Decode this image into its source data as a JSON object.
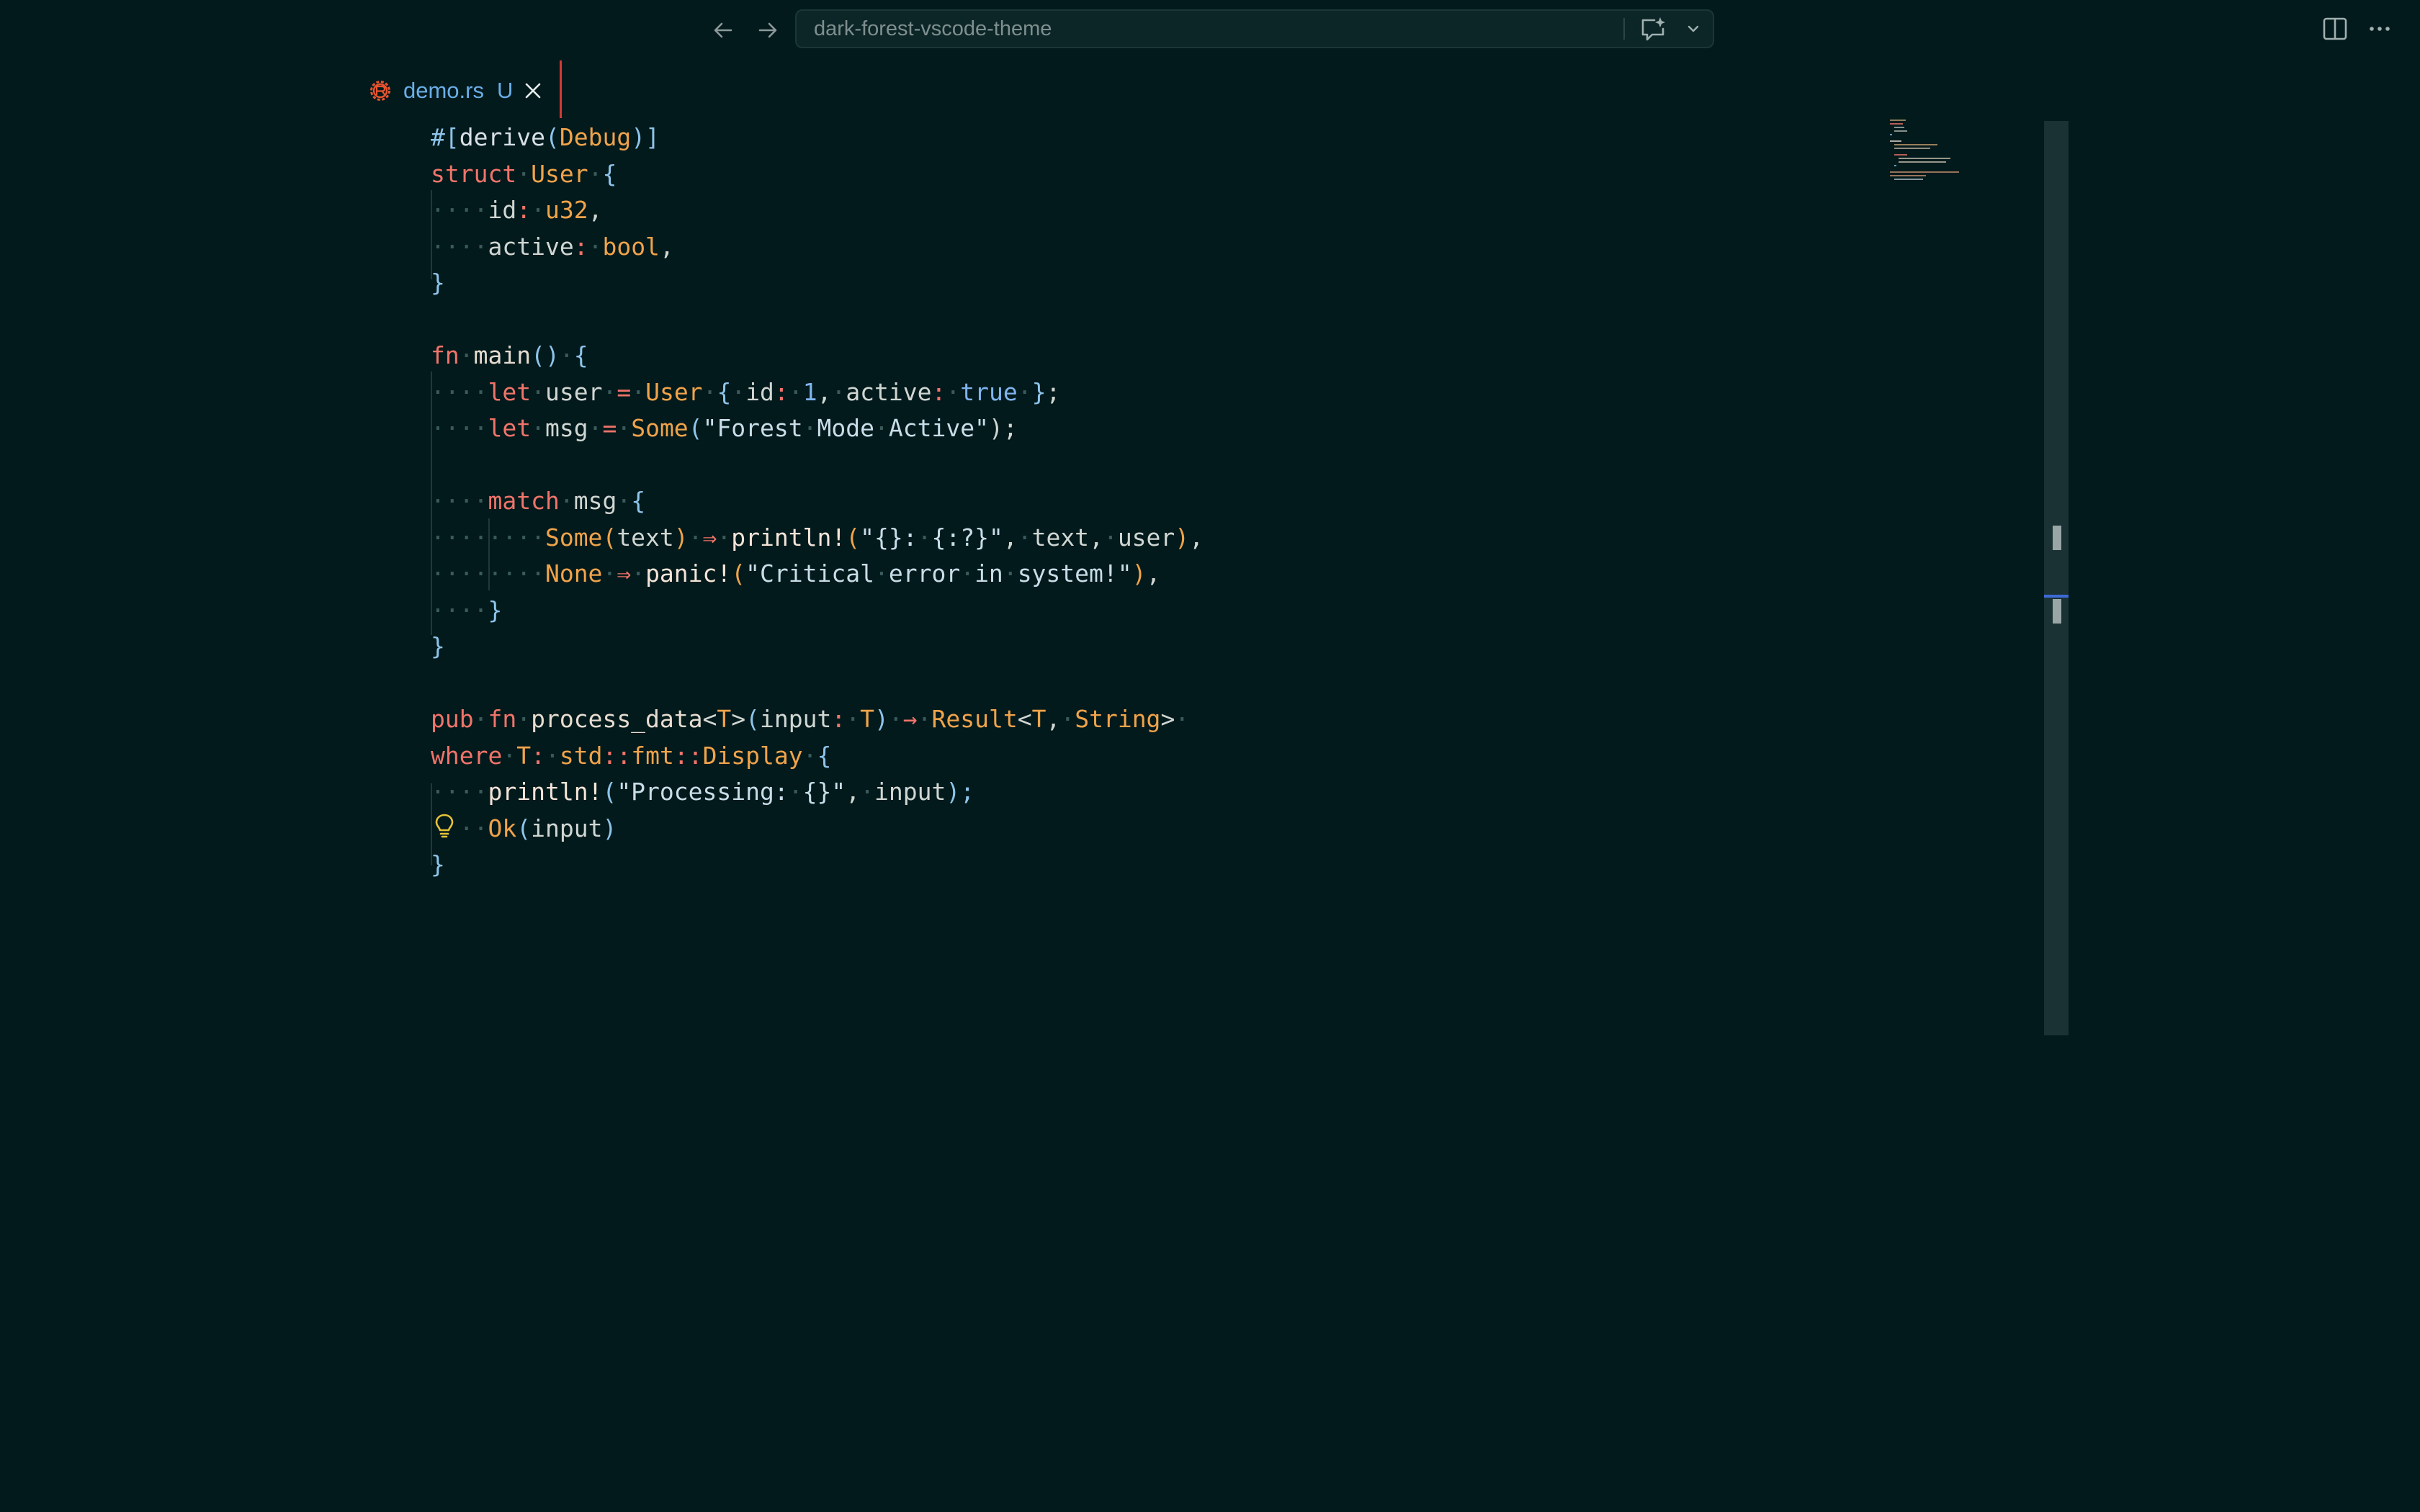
{
  "titlebar": {
    "search_text": "dark-forest-vscode-theme",
    "icons": [
      "arrow-left-icon",
      "arrow-right-icon",
      "chat-sparkle-icon",
      "chevron-down-icon",
      "split-editor-icon",
      "more-icon"
    ]
  },
  "tab": {
    "name": "demo.rs",
    "status": "U",
    "icon": "rust-gear-icon",
    "close_icon": "close-icon"
  },
  "colors": {
    "background": "#031a1c",
    "keyword": "#f0746a",
    "type": "#f0a34a",
    "punctuation": "#8ec4ea",
    "tab_accent": "#d23b32",
    "tab_label": "#6aaee8",
    "cursor_marker": "#3d6ad6"
  },
  "editor": {
    "language": "rust",
    "lines": [
      [
        {
          "t": "#[",
          "c": "pn"
        },
        {
          "t": "derive",
          "c": "attr"
        },
        {
          "t": "(",
          "c": "pn"
        },
        {
          "t": "Debug",
          "c": "ty"
        },
        {
          "t": ")]",
          "c": "pn"
        }
      ],
      [
        {
          "t": "struct",
          "c": "kw"
        },
        {
          "t": "·",
          "c": "ws"
        },
        {
          "t": "User",
          "c": "ty"
        },
        {
          "t": "·",
          "c": "ws"
        },
        {
          "t": "{",
          "c": "pn"
        }
      ],
      [
        {
          "t": "····",
          "c": "ws"
        },
        {
          "t": "id",
          "c": "id"
        },
        {
          "t": ":",
          "c": "kw"
        },
        {
          "t": "·",
          "c": "ws"
        },
        {
          "t": "u32",
          "c": "ty"
        },
        {
          "t": ",",
          "c": "id"
        }
      ],
      [
        {
          "t": "····",
          "c": "ws"
        },
        {
          "t": "active",
          "c": "id"
        },
        {
          "t": ":",
          "c": "kw"
        },
        {
          "t": "·",
          "c": "ws"
        },
        {
          "t": "bool",
          "c": "ty"
        },
        {
          "t": ",",
          "c": "id"
        }
      ],
      [
        {
          "t": "}",
          "c": "pn"
        }
      ],
      [],
      [
        {
          "t": "fn",
          "c": "kw"
        },
        {
          "t": "·",
          "c": "ws"
        },
        {
          "t": "main",
          "c": "fnn"
        },
        {
          "t": "()",
          "c": "pn"
        },
        {
          "t": "·",
          "c": "ws"
        },
        {
          "t": "{",
          "c": "pn"
        }
      ],
      [
        {
          "t": "····",
          "c": "ws"
        },
        {
          "t": "let",
          "c": "kw"
        },
        {
          "t": "·",
          "c": "ws"
        },
        {
          "t": "user",
          "c": "id"
        },
        {
          "t": "·",
          "c": "ws"
        },
        {
          "t": "=",
          "c": "kw"
        },
        {
          "t": "·",
          "c": "ws"
        },
        {
          "t": "User",
          "c": "ty"
        },
        {
          "t": "·",
          "c": "ws"
        },
        {
          "t": "{",
          "c": "pn"
        },
        {
          "t": "·",
          "c": "ws"
        },
        {
          "t": "id",
          "c": "id"
        },
        {
          "t": ":",
          "c": "kw"
        },
        {
          "t": "·",
          "c": "ws"
        },
        {
          "t": "1",
          "c": "nm"
        },
        {
          "t": ",",
          "c": "id"
        },
        {
          "t": "·",
          "c": "ws"
        },
        {
          "t": "active",
          "c": "id"
        },
        {
          "t": ":",
          "c": "kw"
        },
        {
          "t": "·",
          "c": "ws"
        },
        {
          "t": "true",
          "c": "nm"
        },
        {
          "t": "·",
          "c": "ws"
        },
        {
          "t": "}",
          "c": "pn"
        },
        {
          "t": ";",
          "c": "id"
        }
      ],
      [
        {
          "t": "····",
          "c": "ws"
        },
        {
          "t": "let",
          "c": "kw"
        },
        {
          "t": "·",
          "c": "ws"
        },
        {
          "t": "msg",
          "c": "id"
        },
        {
          "t": "·",
          "c": "ws"
        },
        {
          "t": "=",
          "c": "kw"
        },
        {
          "t": "·",
          "c": "ws"
        },
        {
          "t": "Some",
          "c": "ty"
        },
        {
          "t": "(",
          "c": "pn"
        },
        {
          "t": "\"Forest",
          "c": "st"
        },
        {
          "t": "·",
          "c": "ws"
        },
        {
          "t": "Mode",
          "c": "st"
        },
        {
          "t": "·",
          "c": "ws"
        },
        {
          "t": "Active\"",
          "c": "st"
        },
        {
          "t": ");",
          "c": "id"
        }
      ],
      [],
      [
        {
          "t": "····",
          "c": "ws"
        },
        {
          "t": "match",
          "c": "kw"
        },
        {
          "t": "·",
          "c": "ws"
        },
        {
          "t": "msg",
          "c": "id"
        },
        {
          "t": "·",
          "c": "ws"
        },
        {
          "t": "{",
          "c": "pn"
        }
      ],
      [
        {
          "t": "········",
          "c": "ws"
        },
        {
          "t": "Some",
          "c": "ty"
        },
        {
          "t": "(",
          "c": "ty"
        },
        {
          "t": "text",
          "c": "id"
        },
        {
          "t": ")",
          "c": "ty"
        },
        {
          "t": "·",
          "c": "ws"
        },
        {
          "t": "⇒",
          "c": "ar"
        },
        {
          "t": "·",
          "c": "ws"
        },
        {
          "t": "println!",
          "c": "mac"
        },
        {
          "t": "(",
          "c": "ty"
        },
        {
          "t": "\"{}:",
          "c": "st"
        },
        {
          "t": "·",
          "c": "ws"
        },
        {
          "t": "{:?}\"",
          "c": "st"
        },
        {
          "t": ",",
          "c": "id"
        },
        {
          "t": "·",
          "c": "ws"
        },
        {
          "t": "text",
          "c": "id"
        },
        {
          "t": ",",
          "c": "id"
        },
        {
          "t": "·",
          "c": "ws"
        },
        {
          "t": "user",
          "c": "id"
        },
        {
          "t": ")",
          "c": "ty"
        },
        {
          "t": ",",
          "c": "id"
        }
      ],
      [
        {
          "t": "········",
          "c": "ws"
        },
        {
          "t": "None",
          "c": "ty"
        },
        {
          "t": "·",
          "c": "ws"
        },
        {
          "t": "⇒",
          "c": "ar"
        },
        {
          "t": "·",
          "c": "ws"
        },
        {
          "t": "panic!",
          "c": "mac"
        },
        {
          "t": "(",
          "c": "ty"
        },
        {
          "t": "\"Critical",
          "c": "st"
        },
        {
          "t": "·",
          "c": "ws"
        },
        {
          "t": "error",
          "c": "st"
        },
        {
          "t": "·",
          "c": "ws"
        },
        {
          "t": "in",
          "c": "st"
        },
        {
          "t": "·",
          "c": "ws"
        },
        {
          "t": "system!\"",
          "c": "st"
        },
        {
          "t": ")",
          "c": "ty"
        },
        {
          "t": ",",
          "c": "id"
        }
      ],
      [
        {
          "t": "····",
          "c": "ws"
        },
        {
          "t": "}",
          "c": "pn"
        }
      ],
      [
        {
          "t": "}",
          "c": "pn"
        }
      ],
      [],
      [
        {
          "t": "pub",
          "c": "kw"
        },
        {
          "t": "·",
          "c": "ws"
        },
        {
          "t": "fn",
          "c": "kw"
        },
        {
          "t": "·",
          "c": "ws"
        },
        {
          "t": "process_data",
          "c": "fnn"
        },
        {
          "t": "<",
          "c": "id"
        },
        {
          "t": "T",
          "c": "ty"
        },
        {
          "t": ">",
          "c": "id"
        },
        {
          "t": "(",
          "c": "pn"
        },
        {
          "t": "input",
          "c": "id"
        },
        {
          "t": ":",
          "c": "kw"
        },
        {
          "t": "·",
          "c": "ws"
        },
        {
          "t": "T",
          "c": "ty"
        },
        {
          "t": ")",
          "c": "pn"
        },
        {
          "t": "·",
          "c": "ws"
        },
        {
          "t": "→",
          "c": "ar"
        },
        {
          "t": "·",
          "c": "ws"
        },
        {
          "t": "Result",
          "c": "ty"
        },
        {
          "t": "<",
          "c": "id"
        },
        {
          "t": "T",
          "c": "ty"
        },
        {
          "t": ",",
          "c": "id"
        },
        {
          "t": "·",
          "c": "ws"
        },
        {
          "t": "String",
          "c": "ty"
        },
        {
          "t": ">",
          "c": "id"
        },
        {
          "t": "·",
          "c": "ws"
        }
      ],
      [
        {
          "t": "where",
          "c": "kw"
        },
        {
          "t": "·",
          "c": "ws"
        },
        {
          "t": "T",
          "c": "ty"
        },
        {
          "t": ":",
          "c": "kw"
        },
        {
          "t": "·",
          "c": "ws"
        },
        {
          "t": "std",
          "c": "ty"
        },
        {
          "t": "::",
          "c": "kw"
        },
        {
          "t": "fmt",
          "c": "ty"
        },
        {
          "t": "::",
          "c": "kw"
        },
        {
          "t": "Display",
          "c": "ty"
        },
        {
          "t": "·",
          "c": "ws"
        },
        {
          "t": "{",
          "c": "pn"
        }
      ],
      [
        {
          "t": "····",
          "c": "ws"
        },
        {
          "t": "println!",
          "c": "mac"
        },
        {
          "t": "(",
          "c": "pn"
        },
        {
          "t": "\"Processing:",
          "c": "st"
        },
        {
          "t": "·",
          "c": "ws"
        },
        {
          "t": "{}\"",
          "c": "st"
        },
        {
          "t": ",",
          "c": "id"
        },
        {
          "t": "·",
          "c": "ws"
        },
        {
          "t": "input",
          "c": "id"
        },
        {
          "t": ");",
          "c": "pn"
        }
      ],
      [
        {
          "t": "  ··",
          "c": "ws"
        },
        {
          "t": "Ok",
          "c": "ty"
        },
        {
          "t": "(",
          "c": "pn"
        },
        {
          "t": "input",
          "c": "id"
        },
        {
          "t": ")",
          "c": "pn"
        }
      ],
      [
        {
          "t": "}",
          "c": "pn"
        }
      ]
    ],
    "gutter_icon": "lightbulb-icon"
  },
  "scrollbar": {
    "icon": "scrollbar"
  }
}
